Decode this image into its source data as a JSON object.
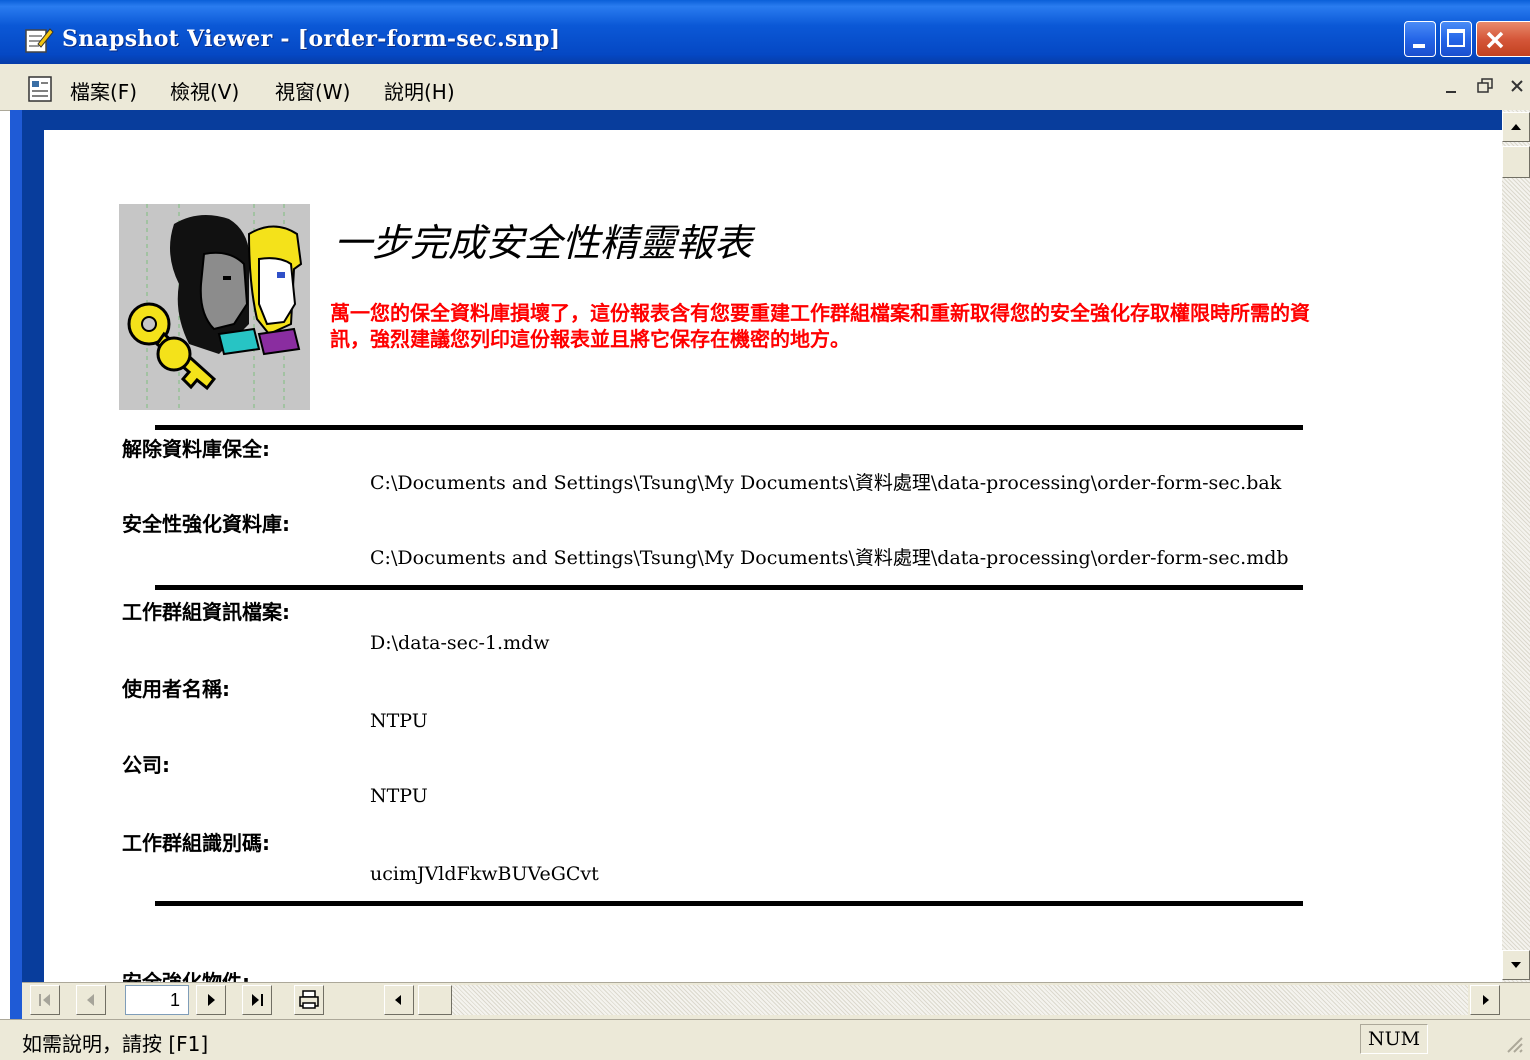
{
  "window": {
    "title": "Snapshot Viewer - [order-form-sec.snp]"
  },
  "menu": {
    "file": "檔案(F)",
    "view": "檢視(V)",
    "window": "視窗(W)",
    "help": "說明(H)"
  },
  "report": {
    "title": "一步完成安全性精靈報表",
    "warning": "萬一您的保全資料庫損壞了，這份報表含有您要重建工作群組檔案和重新取得您的安全強化存取權限時所需的資訊，強烈建議您列印這份報表並且將它保存在機密的地方。",
    "fields": [
      {
        "label": "解除資料庫保全:",
        "value": "C:\\Documents and Settings\\Tsung\\My Documents\\資料處理\\data-processing\\order-form-sec.bak"
      },
      {
        "label": "安全性強化資料庫:",
        "value": "C:\\Documents and Settings\\Tsung\\My Documents\\資料處理\\data-processing\\order-form-sec.mdb"
      },
      {
        "label": "工作群組資訊檔案:",
        "value": "D:\\data-sec-1.mdw"
      },
      {
        "label": "使用者名稱:",
        "value": "NTPU"
      },
      {
        "label": "公司:",
        "value": "NTPU"
      },
      {
        "label": "工作群組識別碼:",
        "value": "ucimJVldFkwBUVeGCvt"
      }
    ],
    "next_section_label": "安全強化物件:"
  },
  "navigation": {
    "page_number": "1"
  },
  "status": {
    "help_text": "如需說明，請按 [F1]",
    "num_indicator": "NUM"
  }
}
